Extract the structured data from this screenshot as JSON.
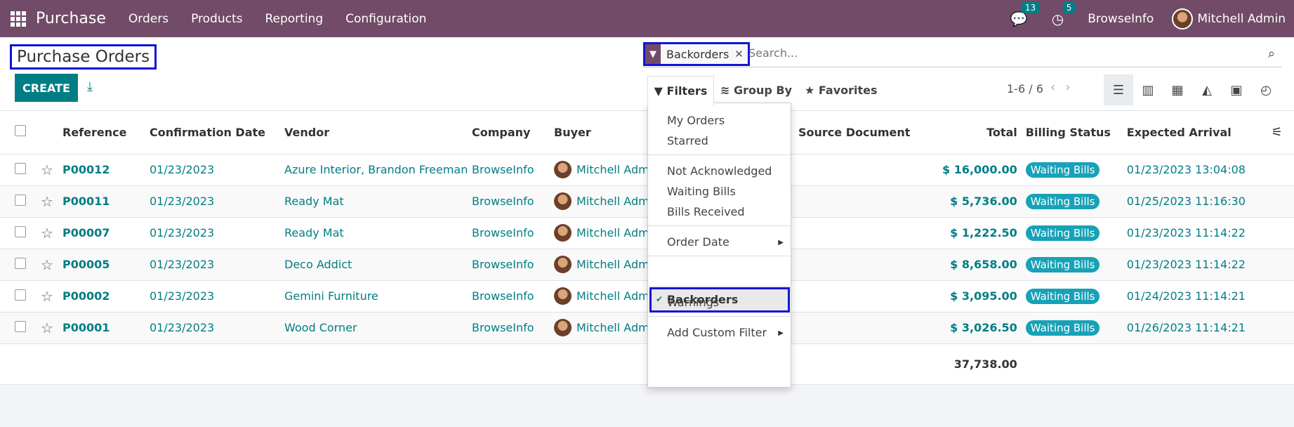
{
  "nav": {
    "app_name": "Purchase",
    "menu": [
      "Orders",
      "Products",
      "Reporting",
      "Configuration"
    ],
    "messages_count": "13",
    "activities_count": "5",
    "company": "BrowseInfo",
    "user": "Mitchell Admin"
  },
  "control": {
    "title": "Purchase Orders",
    "create_label": "CREATE",
    "facet_label": "Backorders",
    "search_placeholder": "Search...",
    "filters_label": "Filters",
    "groupby_label": "Group By",
    "favorites_label": "Favorites",
    "pager": "1-6 / 6"
  },
  "table": {
    "columns": [
      "Reference",
      "Confirmation Date",
      "Vendor",
      "Company",
      "Buyer",
      "Source Document",
      "Total",
      "Billing Status",
      "Expected Arrival"
    ],
    "rows": [
      {
        "ref": "P00012",
        "date": "01/23/2023",
        "vendor": "Azure Interior, Brandon Freeman",
        "company": "BrowseInfo",
        "buyer": "Mitchell Adm",
        "total": "$ 16,000.00",
        "status": "Waiting Bills",
        "arrival": "01/23/2023 13:04:08"
      },
      {
        "ref": "P00011",
        "date": "01/23/2023",
        "vendor": "Ready Mat",
        "company": "BrowseInfo",
        "buyer": "Mitchell Adm",
        "total": "$ 5,736.00",
        "status": "Waiting Bills",
        "arrival": "01/25/2023 11:16:30"
      },
      {
        "ref": "P00007",
        "date": "01/23/2023",
        "vendor": "Ready Mat",
        "company": "BrowseInfo",
        "buyer": "Mitchell Adm",
        "total": "$ 1,222.50",
        "status": "Waiting Bills",
        "arrival": "01/23/2023 11:14:22"
      },
      {
        "ref": "P00005",
        "date": "01/23/2023",
        "vendor": "Deco Addict",
        "company": "BrowseInfo",
        "buyer": "Mitchell Adm",
        "total": "$ 8,658.00",
        "status": "Waiting Bills",
        "arrival": "01/23/2023 11:14:22"
      },
      {
        "ref": "P00002",
        "date": "01/23/2023",
        "vendor": "Gemini Furniture",
        "company": "BrowseInfo",
        "buyer": "Mitchell Adm",
        "total": "$ 3,095.00",
        "status": "Waiting Bills",
        "arrival": "01/24/2023 11:14:21"
      },
      {
        "ref": "P00001",
        "date": "01/23/2023",
        "vendor": "Wood Corner",
        "company": "BrowseInfo",
        "buyer": "Mitchell Adm",
        "total": "$ 3,026.50",
        "status": "Waiting Bills",
        "arrival": "01/26/2023 11:14:21"
      }
    ],
    "sum_total": "37,738.00"
  },
  "dropdown": {
    "my_orders": "My Orders",
    "starred": "Starred",
    "not_acknowledged": "Not Acknowledged",
    "waiting_bills": "Waiting Bills",
    "bills_received": "Bills Received",
    "order_date": "Order Date",
    "backorders": "Backorders",
    "warnings": "Warnings",
    "add_custom_filter": "Add Custom Filter"
  }
}
